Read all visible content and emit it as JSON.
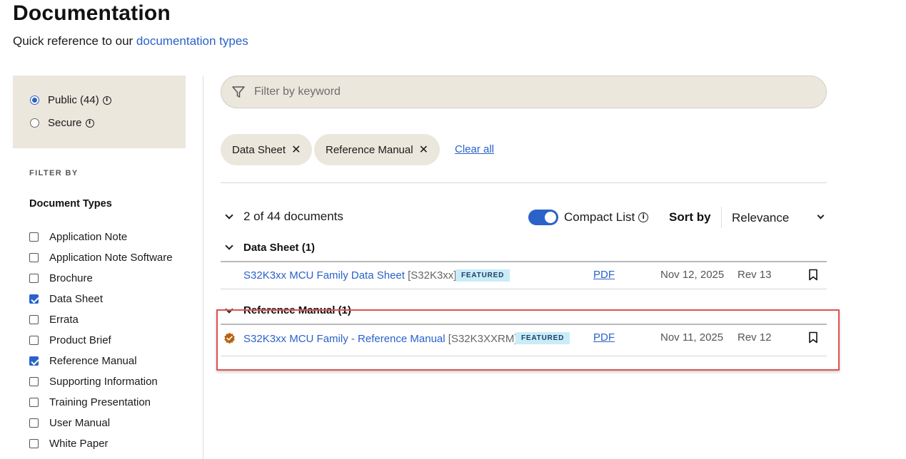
{
  "header": {
    "title": "Documentation",
    "subtitle_prefix": "Quick reference to our ",
    "subtitle_link": "documentation types"
  },
  "access": {
    "options": [
      {
        "label": "Public (44)",
        "checked": true
      },
      {
        "label": "Secure",
        "checked": false
      }
    ]
  },
  "filters": {
    "filter_by_label": "FILTER BY",
    "doc_types_heading": "Document Types",
    "doc_types": [
      {
        "label": "Application Note",
        "checked": false
      },
      {
        "label": "Application Note Software",
        "checked": false
      },
      {
        "label": "Brochure",
        "checked": false
      },
      {
        "label": "Data Sheet",
        "checked": true
      },
      {
        "label": "Errata",
        "checked": false
      },
      {
        "label": "Product Brief",
        "checked": false
      },
      {
        "label": "Reference Manual",
        "checked": true
      },
      {
        "label": "Supporting Information",
        "checked": false
      },
      {
        "label": "Training Presentation",
        "checked": false
      },
      {
        "label": "User Manual",
        "checked": false
      },
      {
        "label": "White Paper",
        "checked": false
      }
    ]
  },
  "search": {
    "placeholder": "Filter by keyword"
  },
  "active_filters": {
    "chips": [
      "Data Sheet",
      "Reference Manual"
    ],
    "clear_all_label": "Clear all"
  },
  "results": {
    "count_label": "2 of 44 documents",
    "compact_list_label": "Compact List",
    "compact_list_on": true,
    "sort_by_label": "Sort by",
    "sort_value": "Relevance",
    "groups": [
      {
        "title": "Data Sheet (1)",
        "documents": [
          {
            "title": "S32K3xx MCU Family Data Sheet",
            "code": "[S32K3xx]",
            "badge": "FEATURED",
            "format": "PDF",
            "date": "Nov 12, 2025",
            "revision": "Rev 13"
          }
        ]
      },
      {
        "title": "Reference Manual (1)",
        "documents": [
          {
            "title": "S32K3xx MCU Family - Reference Manual",
            "code": "[S32K3XXRM]",
            "badge": "FEATURED",
            "format": "PDF",
            "date": "Nov 11, 2025",
            "revision": "Rev 12"
          }
        ]
      }
    ]
  },
  "colors": {
    "accent": "#2a62c9",
    "panel": "#ebe7dd",
    "badge_bg": "#c9ecf8",
    "highlight": "#e05252",
    "featured_icon": "#b8620f"
  }
}
